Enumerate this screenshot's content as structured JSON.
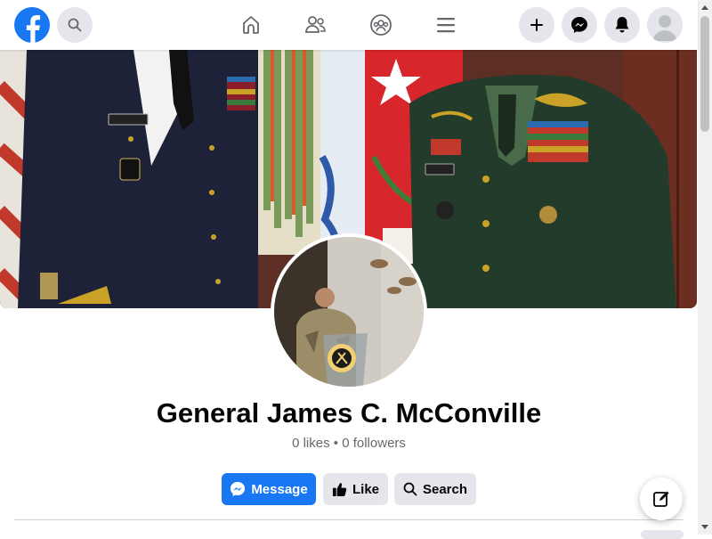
{
  "header": {
    "icons": [
      "facebook-logo",
      "search-icon",
      "home-icon",
      "friends-icon",
      "groups-icon",
      "menu-icon",
      "plus-icon",
      "messenger-icon",
      "bell-icon",
      "avatar"
    ]
  },
  "profile": {
    "name": "General James C. McConville",
    "likes": "0 likes",
    "separator": " • ",
    "followers": "0 followers",
    "cover_description": "",
    "pic_description": ""
  },
  "actions": {
    "message_label": "Message",
    "like_label": "Like",
    "search_label": "Search"
  },
  "colors": {
    "brand": "#1877f2",
    "secondary_bg": "#e4e6eb",
    "text": "#050505",
    "muted": "#65676b"
  }
}
